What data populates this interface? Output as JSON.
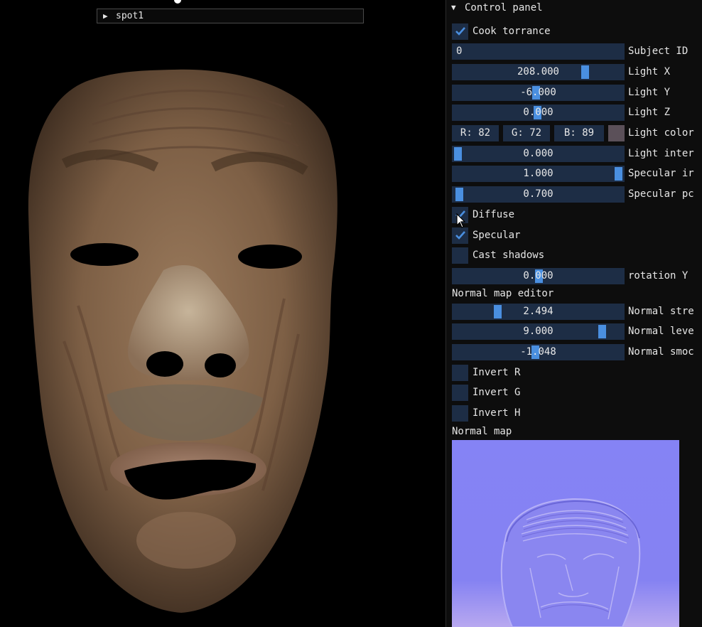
{
  "viewport": {
    "node_label": "spot1"
  },
  "panel": {
    "title": "Control panel",
    "cook_torrance": {
      "label": "Cook torrance",
      "checked": true
    },
    "subject_id": {
      "label": "Subject ID",
      "value": "0"
    },
    "light_x": {
      "label": "Light X",
      "value": "208.000"
    },
    "light_y": {
      "label": "Light Y",
      "value": "-6.000"
    },
    "light_z": {
      "label": "Light Z",
      "value": "0.000"
    },
    "light_color": {
      "label": "Light color",
      "r": "R: 82",
      "g": "G: 72",
      "b": "B: 89",
      "swatch": "#5b5059"
    },
    "light_intensity": {
      "label": "Light inter",
      "value": "0.000"
    },
    "specular_intensity": {
      "label": "Specular ir",
      "value": "1.000"
    },
    "specular_power": {
      "label": "Specular pc",
      "value": "0.700"
    },
    "diffuse": {
      "label": "Diffuse",
      "checked": true
    },
    "specular": {
      "label": "Specular",
      "checked": true
    },
    "cast_shadows": {
      "label": "Cast shadows",
      "checked": false
    },
    "rotation_y": {
      "label": "rotation Y",
      "value": "0.000"
    },
    "normal_map_editor_label": "Normal map editor",
    "normal_strength": {
      "label": "Normal stre",
      "value": "2.494"
    },
    "normal_level": {
      "label": "Normal leve",
      "value": "9.000"
    },
    "normal_smooth": {
      "label": "Normal smoc",
      "value": "-1.048"
    },
    "invert_r": {
      "label": "Invert R",
      "checked": false
    },
    "invert_g": {
      "label": "Invert G",
      "checked": false
    },
    "invert_h": {
      "label": "Invert H",
      "checked": false
    },
    "normal_map_label": "Normal map"
  },
  "colors": {
    "frame_bg": "#1d2d45",
    "slider_grab": "#4a8fe0",
    "check_mark": "#4a8fe0",
    "normal_map_base": "#8482f4"
  }
}
